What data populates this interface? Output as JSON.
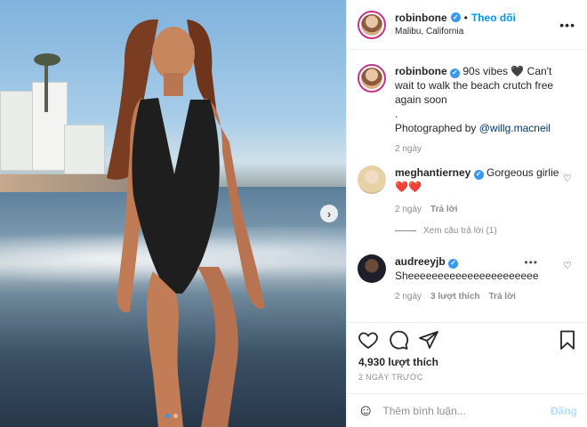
{
  "header": {
    "username": "robinbone",
    "separator": "•",
    "follow_label": "Theo dõi",
    "location": "Malibu, California",
    "more_icon": "more-horizontal-icon"
  },
  "caption": {
    "username": "robinbone",
    "text_line1": "90s vibes 🖤 Can't wait to walk the beach crutch free again soon",
    "text_dot": ".",
    "photographed_by": "Photographed by",
    "mention": "@willg.macneil",
    "time": "2 ngày"
  },
  "comments": [
    {
      "username": "meghantierney",
      "text": "Gorgeous girlie",
      "text2": "❤️❤️",
      "time": "2 ngày",
      "reply_label": "Trả lời",
      "view_replies": "Xem câu trả lời (1)"
    },
    {
      "username": "audreeyjb",
      "text": "Sheeeeeeeeeeeeeeeeeeeeee",
      "time": "2 ngày",
      "likes_label": "3 lượt thích",
      "reply_label": "Trả lời"
    }
  ],
  "likes": "4,930 lượt thích",
  "timestamp": "2 NGÀY TRƯỚC",
  "add_comment": {
    "placeholder": "Thêm bình luận...",
    "post_label": "Đăng"
  },
  "carousel": {
    "current": 1,
    "total": 2
  },
  "colors": {
    "accent": "#0095f6",
    "verified": "#3897f0",
    "muted": "#8e8e8e",
    "post_disabled": "#b2dffc"
  }
}
